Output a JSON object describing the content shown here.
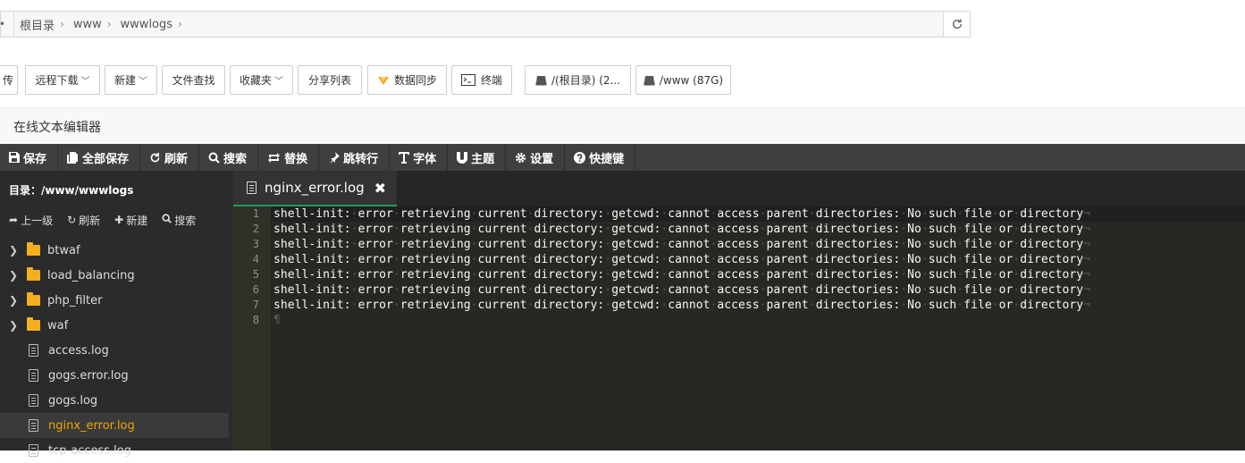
{
  "pathbar": {
    "lead": "•",
    "crumbs": [
      "根目录",
      "www",
      "wwwlogs"
    ],
    "separator": "›"
  },
  "toolbar": [
    {
      "label": "传",
      "caret": false
    },
    {
      "label": "远程下载",
      "caret": true
    },
    {
      "label": "新建",
      "caret": true
    },
    {
      "label": "文件查找",
      "caret": false
    },
    {
      "label": "收藏夹",
      "caret": true
    },
    {
      "label": "分享列表",
      "caret": false
    },
    {
      "label": "数据同步",
      "icon": "sync-icon",
      "caret": false
    },
    {
      "label": "终端",
      "icon": "terminal-icon",
      "caret": false
    },
    {
      "label": "/(根目录) (2...",
      "icon": "disk-icon",
      "caret": false
    },
    {
      "label": "/www (87G)",
      "icon": "disk-icon",
      "caret": false
    }
  ],
  "editor": {
    "window_title": "在线文本编辑器",
    "actions": [
      {
        "label": "保存",
        "icon": "save-icon"
      },
      {
        "label": "全部保存",
        "icon": "save-all-icon"
      },
      {
        "label": "刷新",
        "icon": "refresh-icon"
      },
      {
        "label": "搜索",
        "icon": "search-icon"
      },
      {
        "label": "替换",
        "icon": "replace-icon"
      },
      {
        "label": "跳转行",
        "icon": "jump-icon"
      },
      {
        "label": "字体",
        "icon": "font-icon"
      },
      {
        "label": "主题",
        "icon": "theme-icon"
      },
      {
        "label": "设置",
        "icon": "gear-icon"
      },
      {
        "label": "快捷键",
        "icon": "help-icon"
      }
    ]
  },
  "sidebar": {
    "dir_label": "目录：/www/wwwlogs",
    "actions": [
      {
        "label": "上一级",
        "icon": "up-icon"
      },
      {
        "label": "刷新",
        "icon": "refresh-icon"
      },
      {
        "label": "新建",
        "icon": "plus-icon"
      },
      {
        "label": "搜索",
        "icon": "search-icon"
      }
    ],
    "items": [
      {
        "name": "btwaf",
        "type": "folder"
      },
      {
        "name": "load_balancing",
        "type": "folder"
      },
      {
        "name": "php_filter",
        "type": "folder"
      },
      {
        "name": "waf",
        "type": "folder"
      },
      {
        "name": "access.log",
        "type": "file"
      },
      {
        "name": "gogs.error.log",
        "type": "file"
      },
      {
        "name": "gogs.log",
        "type": "file"
      },
      {
        "name": "nginx_error.log",
        "type": "file",
        "active": true
      },
      {
        "name": "tcp-access.log",
        "type": "file"
      }
    ]
  },
  "tab": {
    "title": "nginx_error.log",
    "close": "✖"
  },
  "code": {
    "lines": [
      "shell-init: error retrieving current directory: getcwd: cannot access parent directories: No such file or directory",
      "shell-init: error retrieving current directory: getcwd: cannot access parent directories: No such file or directory",
      "shell-init: error retrieving current directory: getcwd: cannot access parent directories: No such file or directory",
      "shell-init: error retrieving current directory: getcwd: cannot access parent directories: No such file or directory",
      "shell-init: error retrieving current directory: getcwd: cannot access parent directories: No such file or directory",
      "shell-init: error retrieving current directory: getcwd: cannot access parent directories: No such file or directory",
      "shell-init: error retrieving current directory: getcwd: cannot access parent directories: No such file or directory",
      ""
    ],
    "line_numbers": [
      "1",
      "2",
      "3",
      "4",
      "5",
      "6",
      "7",
      "8"
    ],
    "eol_mark": "¬",
    "eof_mark": "¶"
  },
  "colors": {
    "editor_bg": "#272822",
    "gutter_bg": "#2f3129",
    "sidebar_bg": "#2b2b2b",
    "active_file": "#f0a400",
    "tab_underline": "#1e9b58"
  }
}
